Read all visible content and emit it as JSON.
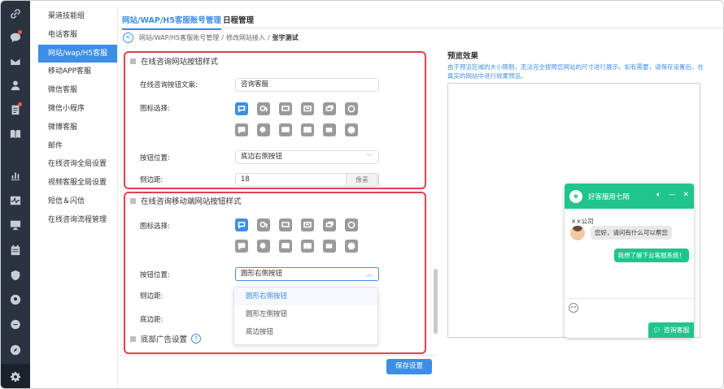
{
  "rail": {
    "icons": [
      "link-icon",
      "chat-icon",
      "mail-icon",
      "user-icon",
      "clipboard-icon",
      "book-icon",
      "bar-chart-icon",
      "pulse-icon",
      "monitor-icon",
      "calendar-icon",
      "shield-icon",
      "location-icon",
      "message-icon",
      "compass-icon",
      "gear-icon"
    ]
  },
  "subnav": {
    "items": [
      "渠道技能组",
      "电话客服",
      "网站/wap/H5客服",
      "移动APP客服",
      "微信客服",
      "微信小程序",
      "微博客服",
      "邮件",
      "在线咨询全局设置",
      "视频客服全局设置",
      "短信＆闪信",
      "在线咨询流程管理"
    ],
    "active_index": 2
  },
  "tabs": [
    "网站/WAP/H5客服账号管理",
    "日程管理"
  ],
  "breadcrumb": {
    "back": "<",
    "part1": "网站/WAP/H5客服账号管理",
    "sep": "/",
    "part2": "修改网站接入",
    "current": "张宇测试"
  },
  "panel1": {
    "title": "在线咨询网站按钮样式",
    "text_label": "在线咨询按钮文案:",
    "text_value": "咨询客服",
    "icon_label": "图标选择:",
    "position_label": "按钮位置:",
    "position_value": "底边右侧按钮",
    "margin_label": "侧边距:",
    "margin_value": "18",
    "margin_unit": "像素"
  },
  "panel2": {
    "title": "在线咨询移动端网站按钮样式",
    "icon_label": "图标选择:",
    "position_label": "按钮位置:",
    "position_value": "圆形右侧按钮",
    "side_label": "侧边距:",
    "bottom_label": "底边距:",
    "dropdown_options": [
      "圆形右侧按钮",
      "圆形左侧按钮",
      "底边按钮"
    ]
  },
  "ad": {
    "title": "底部广告设置",
    "help": "?"
  },
  "save_label": "保存设置",
  "preview": {
    "title": "预览效果",
    "desc": "由于预览区域的大小限制，无法完全按照您网站的尺寸进行展示，如有需要，请保存设置后，在真实的网站中进行效果预览。"
  },
  "chat": {
    "title": "好客服用七陌",
    "company": "××公司",
    "greeting": "您好，请问有什么可以帮您",
    "reply": "我想了解下云客服系统！",
    "consult_label": "咨询客服"
  },
  "colors": {
    "accent": "#3e8ee6",
    "highlight": "#e0424d",
    "chat_green": "#21c48d",
    "rail": "#2b3340"
  }
}
